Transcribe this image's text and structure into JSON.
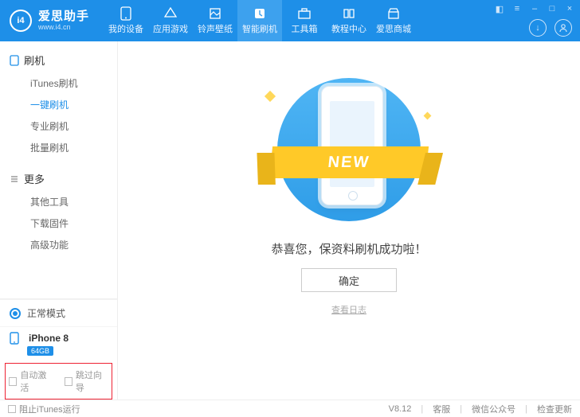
{
  "brand": {
    "title": "爱思助手",
    "subtitle": "www.i4.cn",
    "logo_text": "i4"
  },
  "nav": {
    "items": [
      {
        "label": "我的设备"
      },
      {
        "label": "应用游戏"
      },
      {
        "label": "铃声壁纸"
      },
      {
        "label": "智能刷机"
      },
      {
        "label": "工具箱"
      },
      {
        "label": "教程中心"
      },
      {
        "label": "爱思商城"
      }
    ],
    "active_index": 3
  },
  "sidebar": {
    "sections": [
      {
        "title": "刷机",
        "items": [
          "iTunes刷机",
          "一键刷机",
          "专业刷机",
          "批量刷机"
        ],
        "active_index": 1
      },
      {
        "title": "更多",
        "items": [
          "其他工具",
          "下载固件",
          "高级功能"
        ],
        "active_index": -1
      }
    ],
    "mode": "正常模式",
    "device": {
      "name": "iPhone 8",
      "storage": "64GB"
    },
    "bottom_checks": {
      "auto_activate": "自动激活",
      "skip_guide": "跳过向导"
    }
  },
  "main": {
    "ribbon": "NEW",
    "message": "恭喜您，保资料刷机成功啦！",
    "ok": "确定",
    "log": "查看日志"
  },
  "footer": {
    "block_itunes": "阻止iTunes运行",
    "version": "V8.12",
    "support": "客服",
    "wechat": "微信公众号",
    "update": "检查更新"
  }
}
